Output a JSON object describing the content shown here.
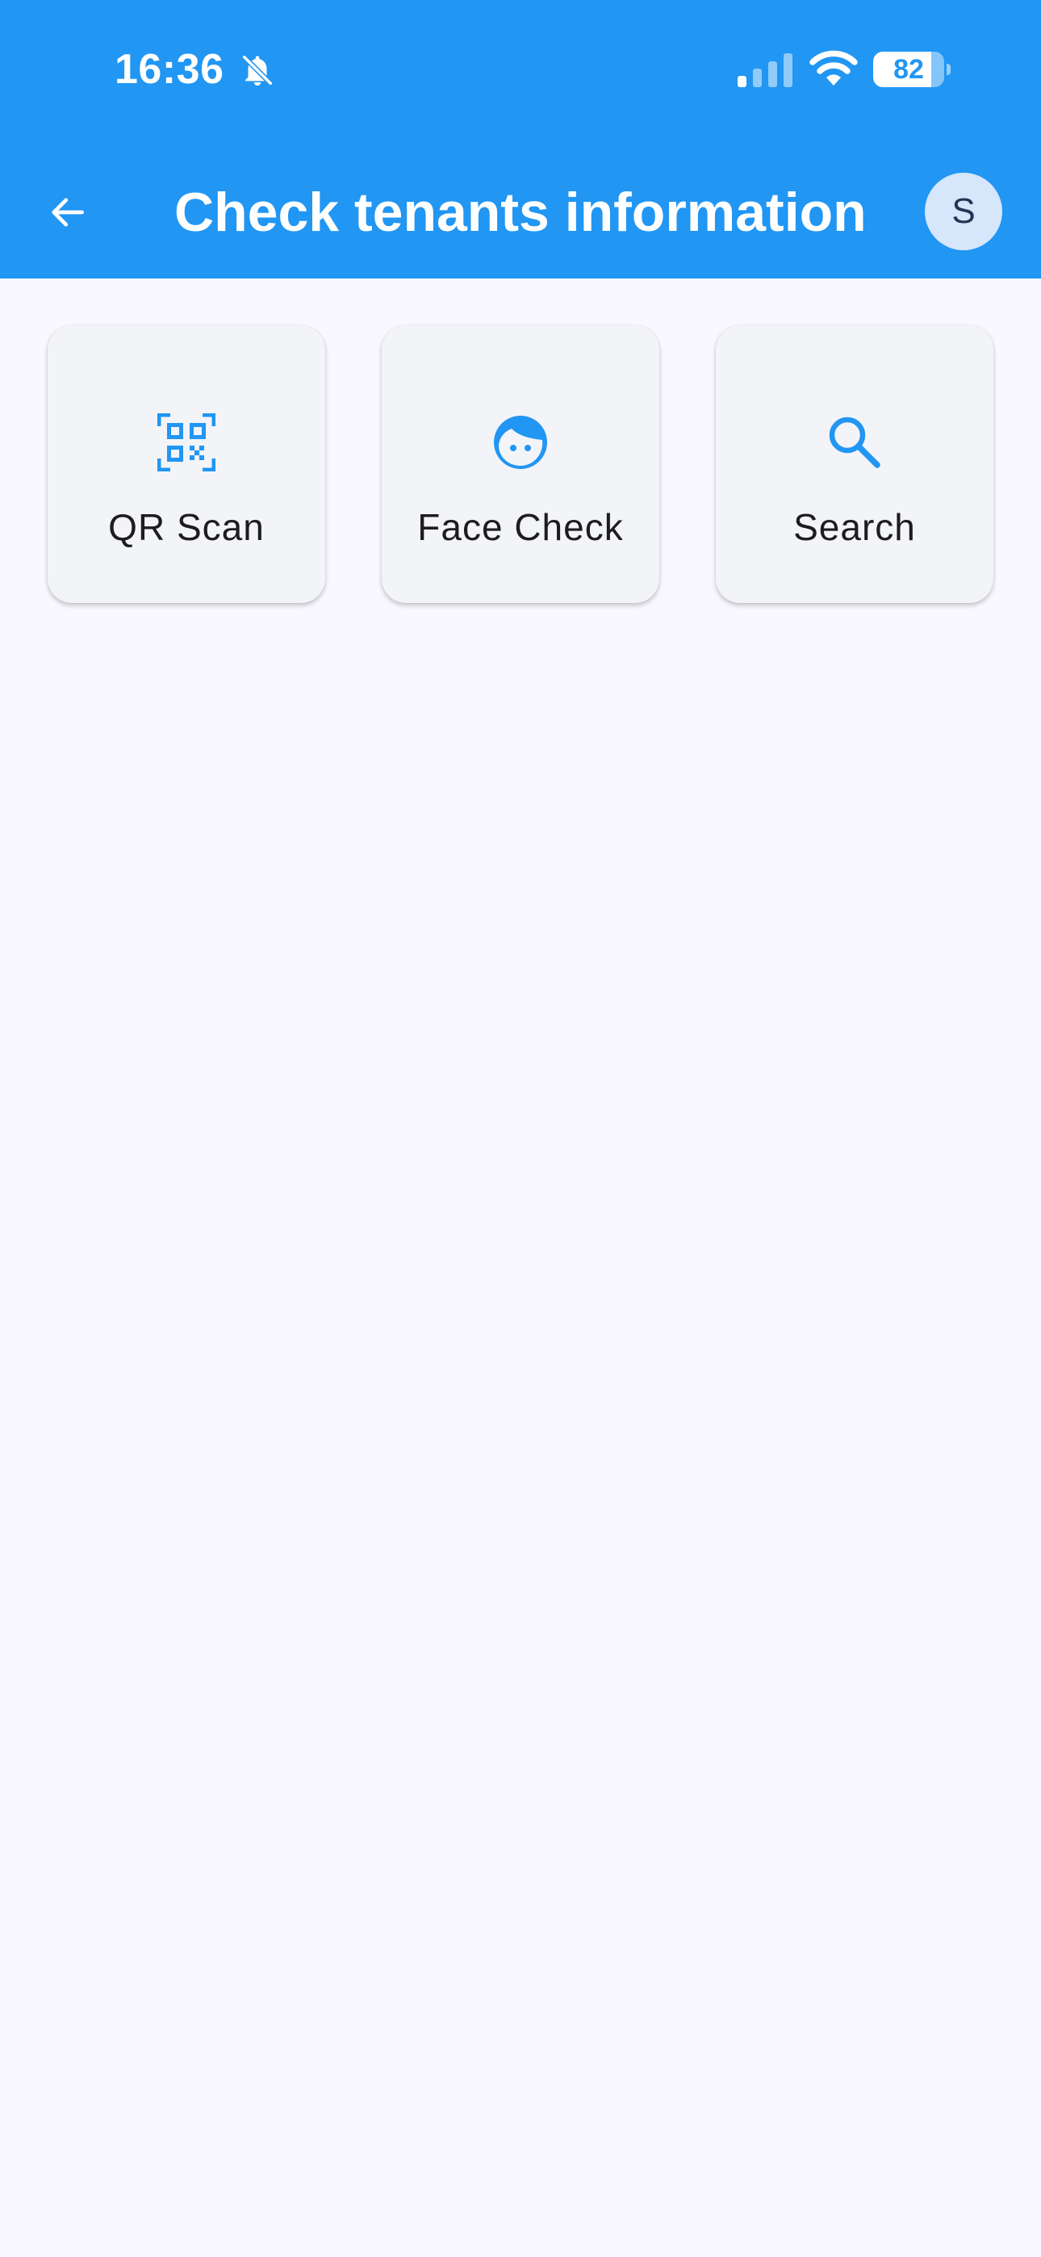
{
  "status_bar": {
    "time": "16:36",
    "battery_level": "82",
    "battery_fraction": 0.82,
    "icons": [
      "bell-off-icon",
      "cellular-signal-icon",
      "wifi-icon",
      "battery-icon"
    ]
  },
  "app_bar": {
    "title": "Check tenants information",
    "avatar_initial": "S",
    "back_icon": "arrow-left-icon"
  },
  "actions": [
    {
      "label": "QR Scan",
      "icon": "qr-code-icon"
    },
    {
      "label": "Face Check",
      "icon": "face-icon"
    },
    {
      "label": "Search",
      "icon": "search-icon"
    }
  ],
  "colors": {
    "primary": "#2196f3",
    "background": "#f8f8fe",
    "card": "#f3f4f8",
    "avatar_bg": "#d6e6fb",
    "text": "#1c1c22"
  }
}
